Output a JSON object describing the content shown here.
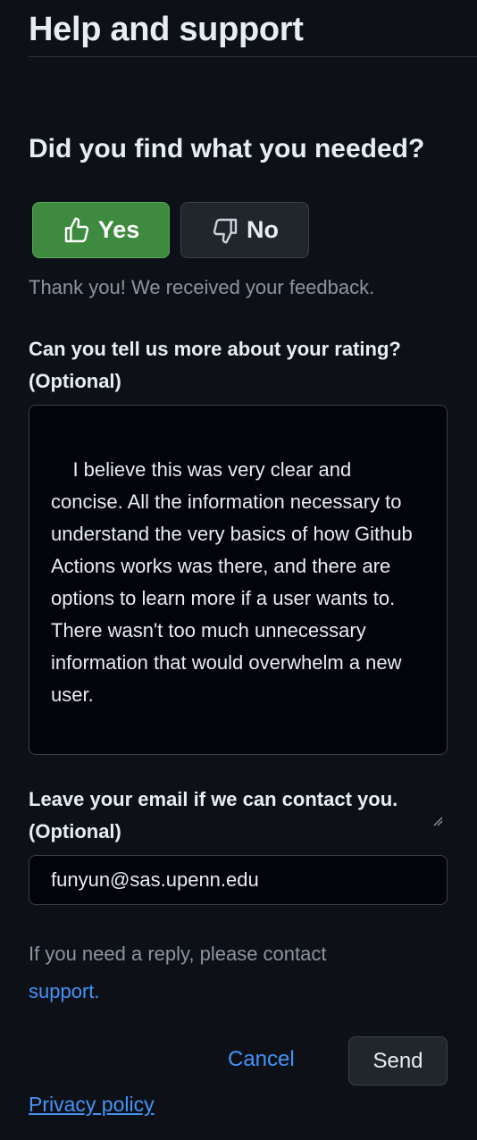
{
  "header": {
    "title": "Help and support"
  },
  "feedback": {
    "question": "Did you find what you needed?",
    "yes_label": "Yes",
    "no_label": "No",
    "yes_icon": "thumbs-up-icon",
    "no_icon": "thumbs-down-icon",
    "confirmation": "Thank you! We received your feedback."
  },
  "rating_details": {
    "label": "Can you tell us more about your rating? (Optional)",
    "value": "I believe this was very clear and concise. All the information necessary to understand the very basics of how Github Actions works was there, and there are options to learn more if a user wants to. There wasn't too much unnecessary information that would overwhelm a new user."
  },
  "email": {
    "label": "Leave your email if we can contact you. (Optional)",
    "value": "funyun@sas.upenn.edu"
  },
  "reply_note": {
    "text": "If you need a reply, please contact ",
    "link_label": "support."
  },
  "actions": {
    "cancel_label": "Cancel",
    "send_label": "Send"
  },
  "footer": {
    "privacy_label": "Privacy policy"
  },
  "colors": {
    "background": "#0d1117",
    "yes_button": "#3e8a3f",
    "link": "#4493f8",
    "muted_text": "#8b949e"
  }
}
